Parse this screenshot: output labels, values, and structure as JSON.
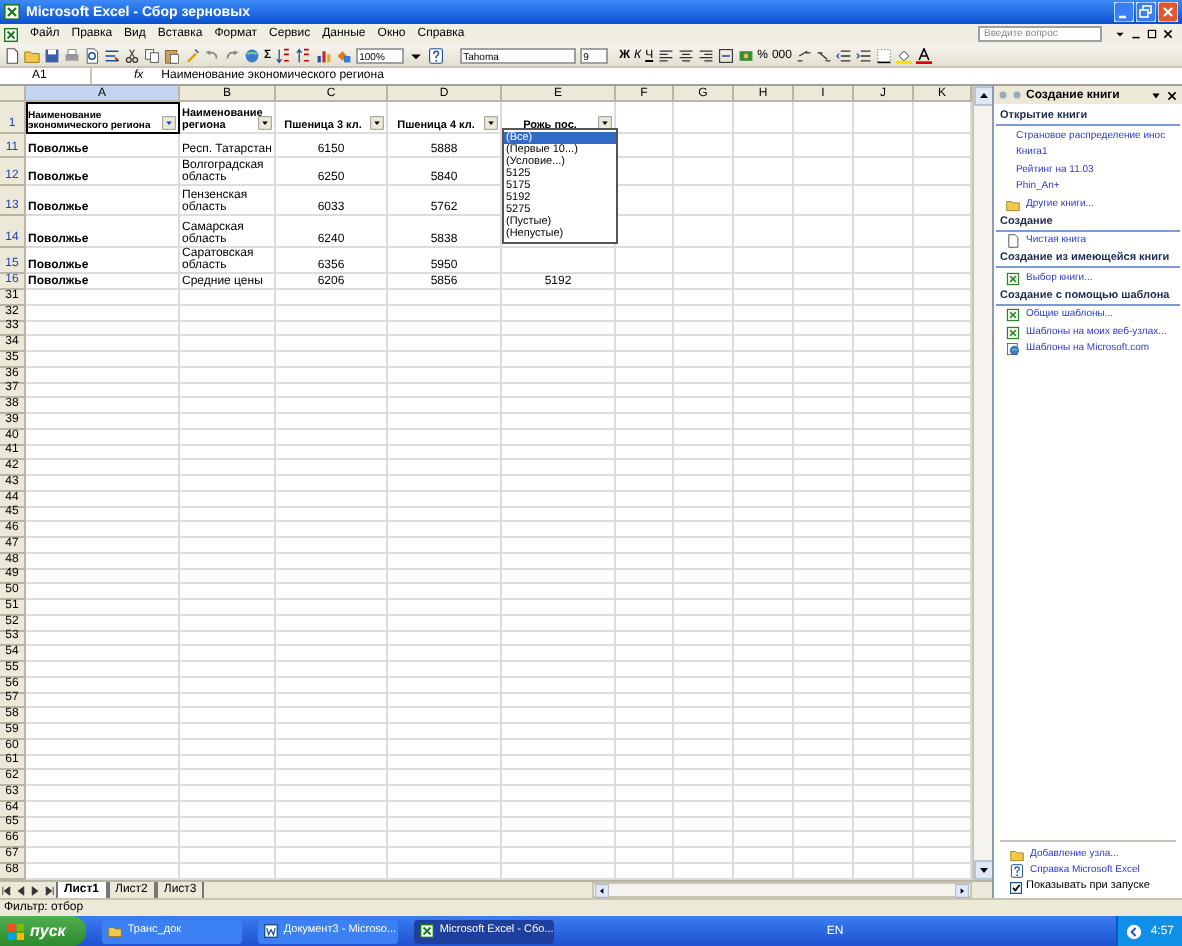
{
  "window": {
    "title": "Microsoft Excel - Сбор зерновых"
  },
  "menu": [
    "Файл",
    "Правка",
    "Вид",
    "Вставка",
    "Формат",
    "Сервис",
    "Данные",
    "Окно",
    "Справка"
  ],
  "help_box": {
    "placeholder": "Введите вопрос"
  },
  "toolbar": {
    "sum": "Σ",
    "zoom": "100%",
    "font": "Tahoma",
    "font_size": "9",
    "format_buttons": [
      "Ж",
      "К",
      "Ч"
    ],
    "percent": "%",
    "thousands": "000"
  },
  "formula_bar": {
    "cell": "A1",
    "fx": "fx",
    "content": "Наименование экономического региона"
  },
  "columns": [
    {
      "label": "A",
      "selected": true
    },
    {
      "label": "B",
      "selected": false
    },
    {
      "label": "C",
      "selected": false
    },
    {
      "label": "D",
      "selected": false
    },
    {
      "label": "E",
      "selected": false
    },
    {
      "label": "F",
      "selected": false
    },
    {
      "label": "G",
      "selected": false
    },
    {
      "label": "H",
      "selected": false
    },
    {
      "label": "I",
      "selected": false
    },
    {
      "label": "J",
      "selected": false
    },
    {
      "label": "K",
      "selected": false
    }
  ],
  "header_row": {
    "number": "1",
    "cells": [
      "Наименование экономического региона",
      "Наименование региона",
      "Пшеница 3 кл.",
      "Пшеница 4 кл.",
      "Рожь пос."
    ]
  },
  "rows": [
    {
      "number": "11",
      "filtered": true,
      "cells": [
        "Поволжье",
        "Респ. Татарстан",
        "6150",
        "5888"
      ]
    },
    {
      "number": "12",
      "filtered": true,
      "cells": [
        "Поволжье",
        "Волгоградская область",
        "6250",
        "5840"
      ]
    },
    {
      "number": "13",
      "filtered": true,
      "cells": [
        "Поволжье",
        "Пензенская область",
        "6033",
        "5762"
      ]
    },
    {
      "number": "14",
      "filtered": true,
      "cells": [
        "Поволжье",
        "Самарская область",
        "6240",
        "5838"
      ]
    },
    {
      "number": "15",
      "filtered": true,
      "cells": [
        "Поволжье",
        "Саратовская область",
        "6356",
        "5950"
      ]
    },
    {
      "number": "16",
      "filtered": true,
      "cells": [
        "Поволжье",
        "Средние цены",
        "6206",
        "5856",
        "5192"
      ]
    }
  ],
  "empty_rows": [
    "31",
    "32",
    "33",
    "34",
    "35",
    "36",
    "37",
    "38",
    "39",
    "40",
    "41",
    "42",
    "43",
    "44",
    "45",
    "46",
    "47",
    "48",
    "49",
    "50",
    "51",
    "52",
    "53",
    "54",
    "55",
    "56",
    "57",
    "58",
    "59",
    "60",
    "61",
    "62",
    "63",
    "64",
    "65",
    "66",
    "67",
    "68"
  ],
  "filter_list": [
    {
      "label": "(Все)",
      "selected": true
    },
    {
      "label": "(Первые 10...)",
      "selected": false
    },
    {
      "label": "(Условие...)",
      "selected": false
    },
    {
      "label": "5125",
      "selected": false
    },
    {
      "label": "5175",
      "selected": false
    },
    {
      "label": "5192",
      "selected": false
    },
    {
      "label": "5275",
      "selected": false
    },
    {
      "label": "(Пустые)",
      "selected": false
    },
    {
      "label": "(Непустые)",
      "selected": false
    }
  ],
  "task_pane": {
    "title": "Создание книги",
    "sections": [
      {
        "title": "Открытие книги",
        "items": [
          {
            "label": "Страновое распределение инос",
            "kind": "link"
          },
          {
            "label": "Книга1",
            "kind": "link"
          },
          {
            "label": "Рейтинг на 11.03",
            "kind": "link"
          },
          {
            "label": "Phin_An+",
            "kind": "link"
          },
          {
            "label": "Другие книги...",
            "kind": "folder"
          }
        ]
      },
      {
        "title": "Создание",
        "items": [
          {
            "label": "Чистая книга",
            "kind": "page"
          }
        ]
      },
      {
        "title": "Создание из имеющейся книги",
        "items": [
          {
            "label": "Выбор книги...",
            "kind": "sheet"
          }
        ]
      },
      {
        "title": "Создание с помощью шаблона",
        "items": [
          {
            "label": "Общие шаблоны...",
            "kind": "sheet"
          },
          {
            "label": "Шаблоны на моих веб-узлах...",
            "kind": "sheet"
          },
          {
            "label": "Шаблоны на Microsoft.com",
            "kind": "globe"
          }
        ]
      }
    ],
    "footer": [
      {
        "label": "Добавление узла...",
        "kind": "folder"
      },
      {
        "label": "Справка Microsoft Excel",
        "kind": "help"
      }
    ],
    "startup_checkbox": {
      "label": "Показывать при запуске",
      "checked": true
    }
  },
  "sheet_tabs": [
    {
      "label": "Лист1",
      "selected": true
    },
    {
      "label": "Лист2",
      "selected": false
    },
    {
      "label": "Лист3",
      "selected": false
    }
  ],
  "status_bar": "Фильтр: отбор",
  "taskbar": {
    "start": "пуск",
    "buttons": [
      {
        "label": "Транс_док",
        "kind": "folder",
        "selected": false
      },
      {
        "label": "Документ3 - Microso...",
        "kind": "word",
        "selected": false
      },
      {
        "label": "Microsoft Excel - Сбо...",
        "kind": "excel",
        "selected": true
      }
    ],
    "language": "EN",
    "clock": "4:57"
  }
}
